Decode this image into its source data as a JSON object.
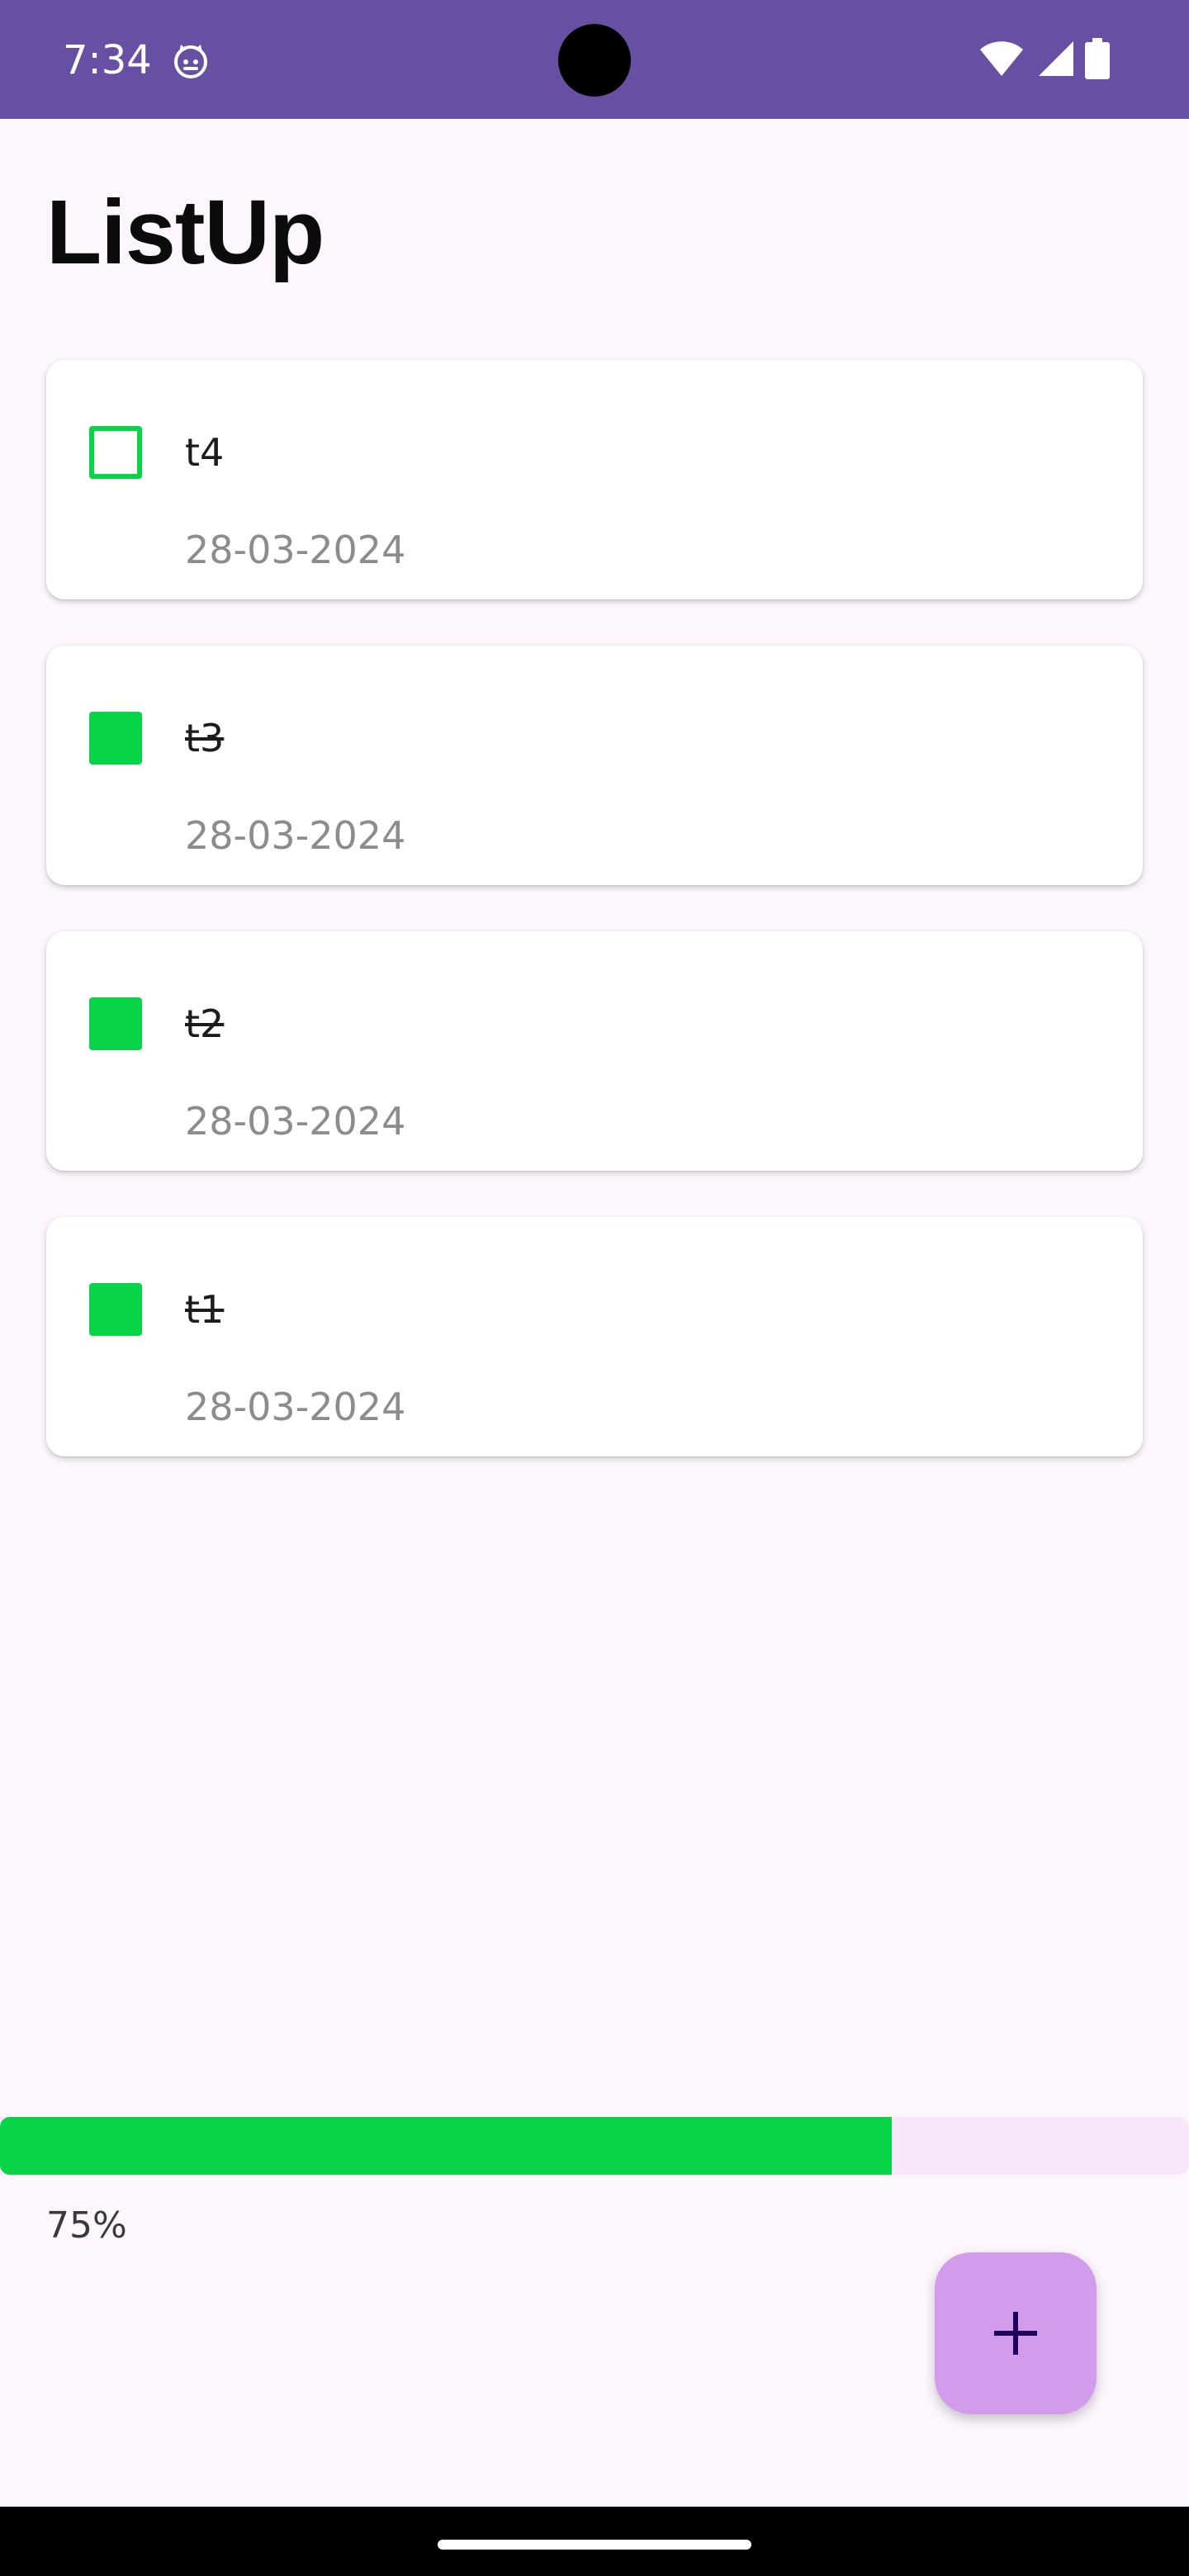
{
  "status_bar": {
    "time": "7:34",
    "app_icon": "android-cat-icon",
    "icons": [
      "wifi-icon",
      "signal-icon",
      "battery-icon"
    ],
    "background": "#6750a4"
  },
  "app": {
    "title": "ListUp"
  },
  "tasks": [
    {
      "name": "t4",
      "date": "28-03-2024",
      "done": false
    },
    {
      "name": "t3",
      "date": "28-03-2024",
      "done": true
    },
    {
      "name": "t2",
      "date": "28-03-2024",
      "done": true
    },
    {
      "name": "t1",
      "date": "28-03-2024",
      "done": true
    }
  ],
  "progress": {
    "value": 0.75,
    "label": "75%",
    "fill_color": "#08d448",
    "track_color": "#f8e6fb"
  },
  "fab": {
    "icon": "plus-icon",
    "color": "#d29bec"
  },
  "colors": {
    "accent_green": "#08d448",
    "background": "#fdf7fd"
  }
}
